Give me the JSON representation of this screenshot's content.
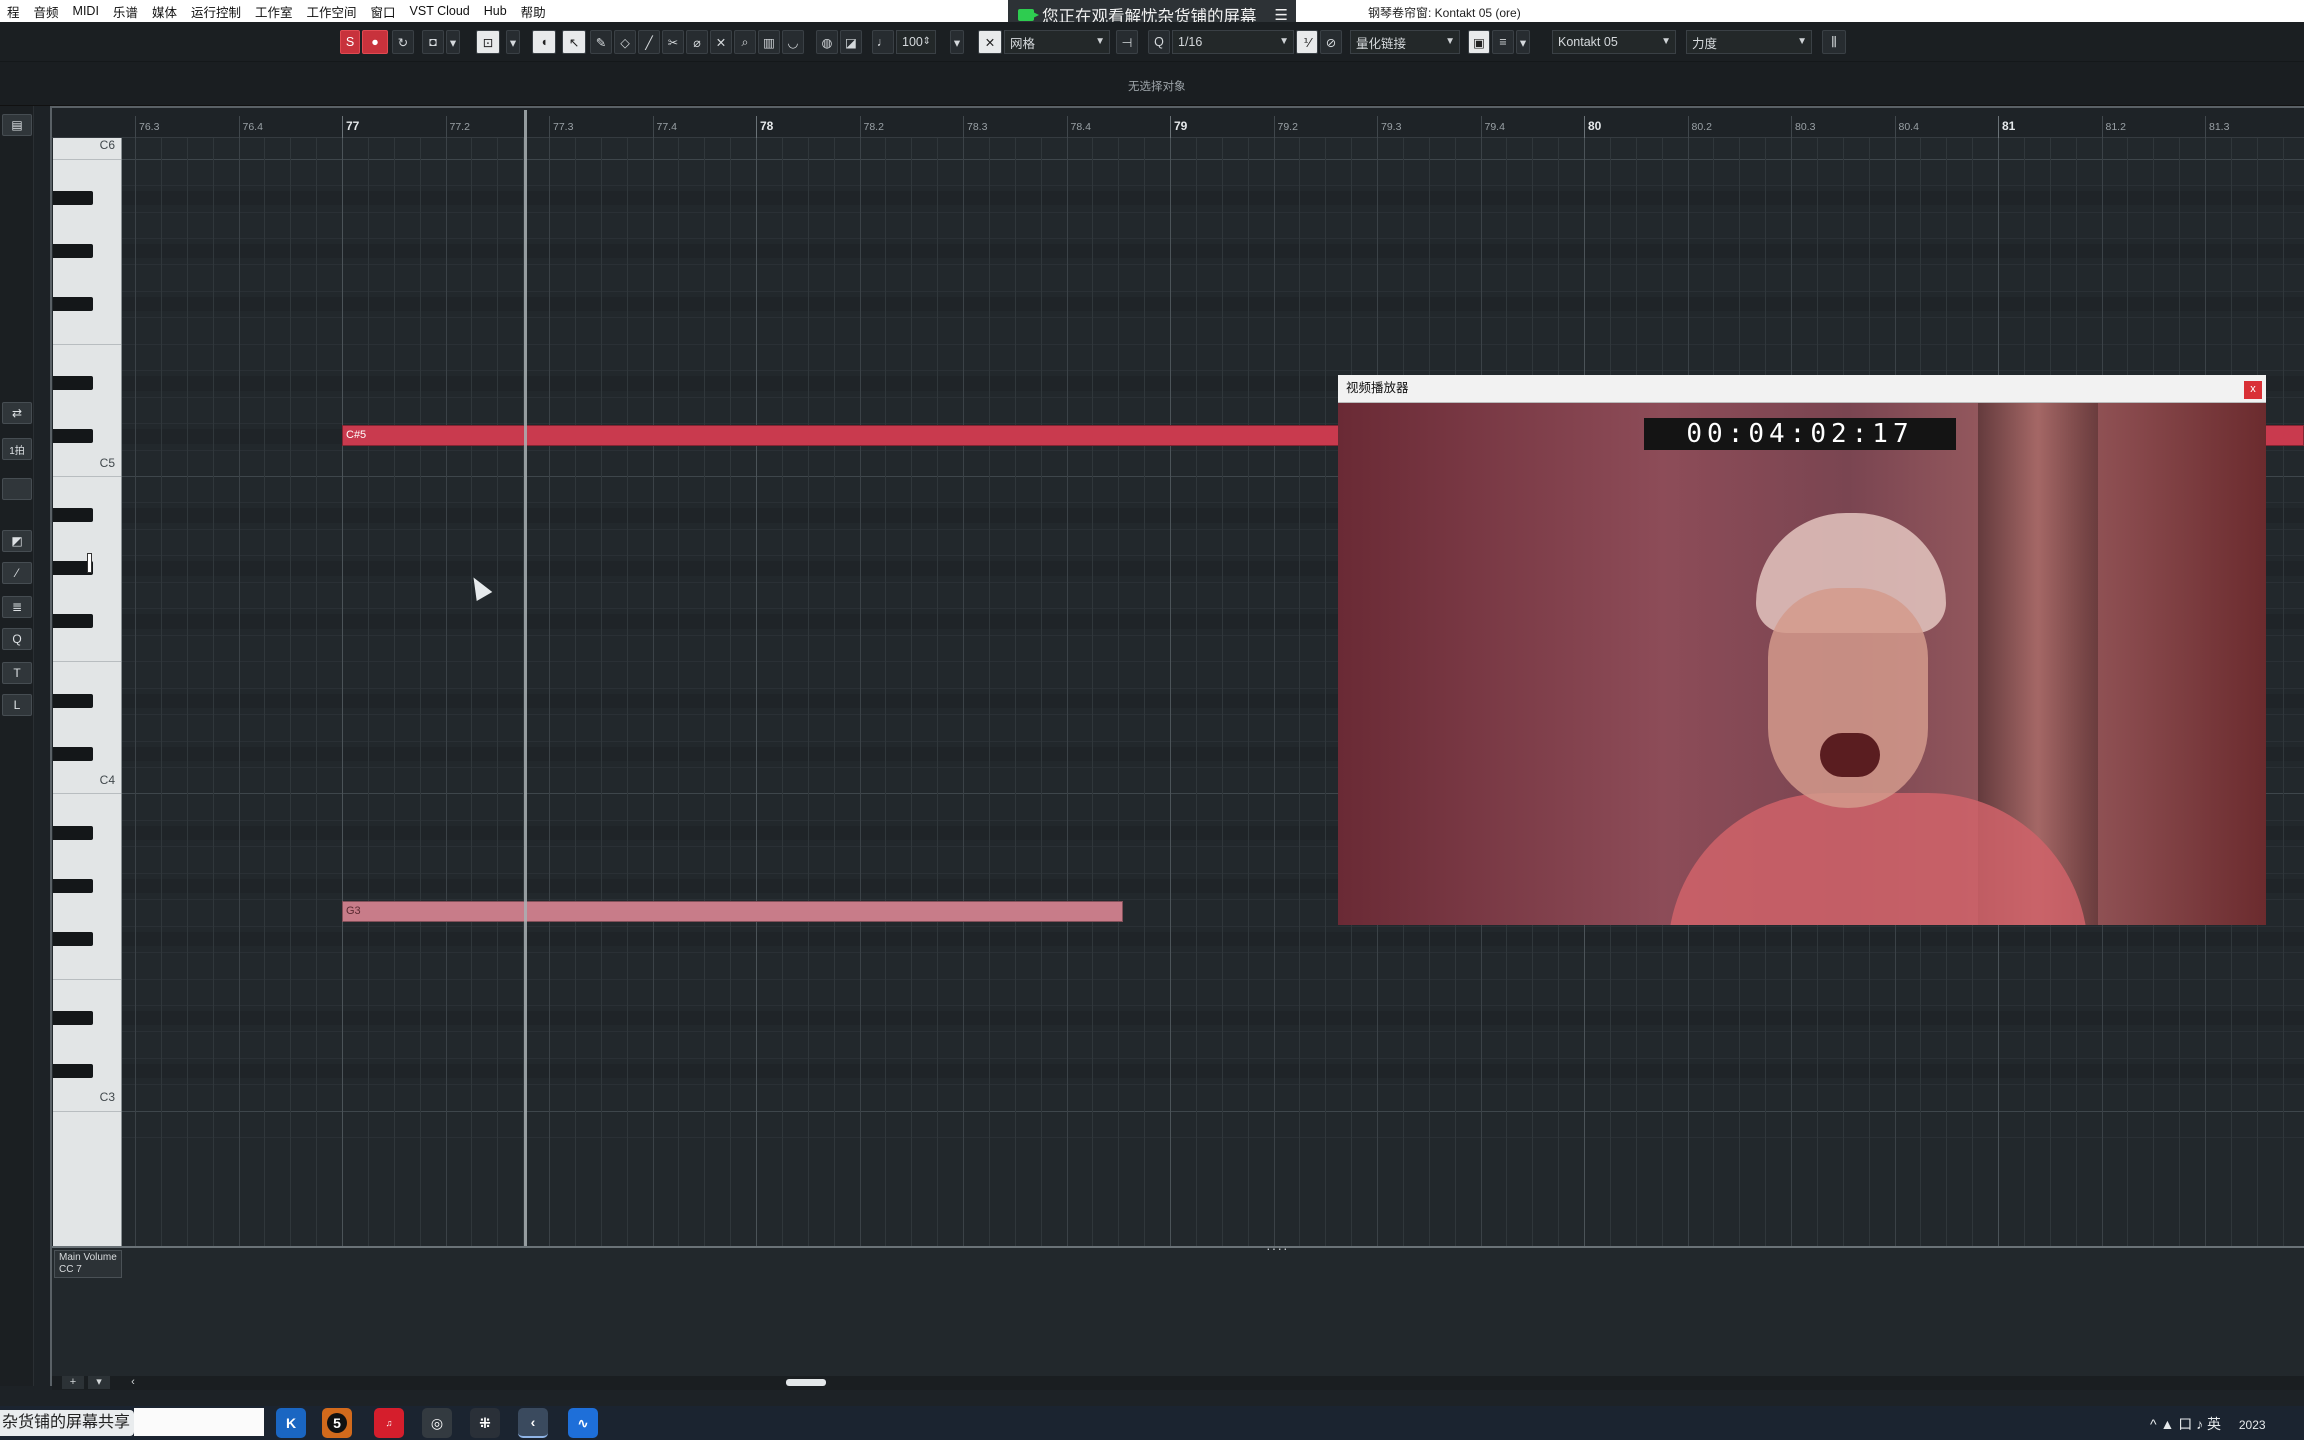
{
  "menubar": {
    "items": [
      "程",
      "音频",
      "MIDI",
      "乐谱",
      "媒体",
      "运行控制",
      "工作室",
      "工作空间",
      "窗口",
      "VST Cloud",
      "Hub",
      "帮助"
    ],
    "window_title": "钢琴卷帘窗: Kontakt 05 (ore)"
  },
  "share_banner": {
    "text": "您正在观看解忧杂货铺的屏幕",
    "menu_glyph": "☰"
  },
  "toolbar": {
    "velocity": "100",
    "snap_type": "网格",
    "quantize": "1/16",
    "quantize_link": "量化链接",
    "instrument": "Kontakt 05",
    "controller": "力度"
  },
  "infobar": {
    "status": "无选择对象"
  },
  "left_strip": {
    "selector": "1拍",
    "tools": [
      "Q",
      "T",
      "L"
    ]
  },
  "ruler": {
    "labels": [
      "76.3",
      "76.4",
      "77",
      "77.2",
      "77.3",
      "77.4",
      "78",
      "78.2",
      "78.3",
      "78.4",
      "79",
      "79.2",
      "79.3",
      "79.4",
      "80",
      "80.2",
      "80.3",
      "80.4",
      "81",
      "81.2",
      "81.3"
    ],
    "bars": [
      "77",
      "78",
      "79",
      "80",
      "81"
    ]
  },
  "keyboard": {
    "labels": [
      "C6",
      "C5",
      "C4",
      "C3"
    ]
  },
  "notes": [
    {
      "pitch": "C#5",
      "start": 77,
      "end_beyond": true,
      "color": "#c93a4e"
    },
    {
      "pitch": "G3",
      "start": 77,
      "end": 78.4,
      "color": "#c87c89"
    }
  ],
  "controller_lane": {
    "name": "Main Volume",
    "cc": "CC 7"
  },
  "video_player": {
    "title": "视频播放器",
    "close": "x",
    "timecode": "00:04:02:17"
  },
  "taskbar": {
    "share_text": "杂货铺的屏幕共享",
    "apps": [
      "K",
      "5",
      "网易云",
      "O",
      "⁜",
      "‹",
      "∿"
    ],
    "tray_text": "^ ▲ 口 ♪ 英",
    "clock": "2023"
  },
  "colors": {
    "accent": "#c8323c",
    "note_main": "#c93a4e",
    "note_light": "#c87c89",
    "background": "#22282c"
  }
}
